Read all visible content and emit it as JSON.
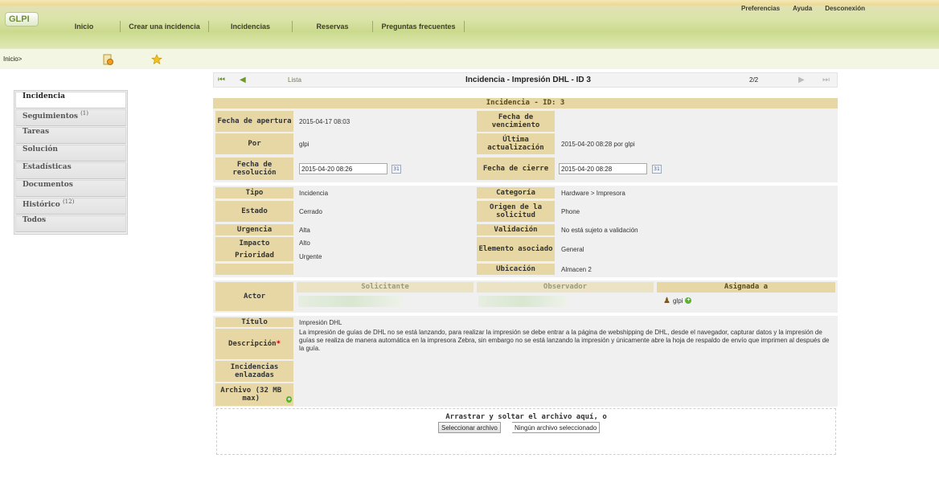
{
  "app": {
    "logo_text": "GLPI"
  },
  "header": {
    "nav": [
      "Inicio",
      "Crear una incidencia",
      "Incidencias",
      "Reservas",
      "Preguntas frecuentes"
    ],
    "user_links": [
      "Preferencias",
      "Ayuda",
      "Desconexión"
    ]
  },
  "breadcrumb": {
    "text": "Inicio>"
  },
  "sidebar": {
    "tabs": [
      {
        "label": "Incidencia",
        "count": "",
        "active": true
      },
      {
        "label": "Seguimientos",
        "count": "(1)",
        "active": false
      },
      {
        "label": "Tareas",
        "count": "",
        "active": false
      },
      {
        "label": "Solución",
        "count": "",
        "active": false
      },
      {
        "label": "Estadísticas",
        "count": "",
        "active": false
      },
      {
        "label": "Documentos",
        "count": "",
        "active": false
      },
      {
        "label": "Histórico",
        "count": "(12)",
        "active": false
      },
      {
        "label": "Todos",
        "count": "",
        "active": false
      }
    ]
  },
  "formnav": {
    "list_label": "Lista",
    "title": "Incidencia - Impresión DHL - ID 3",
    "position": "2/2"
  },
  "ticket": {
    "header": "Incidencia - ID: 3",
    "labels": {
      "fecha_apertura": "Fecha de apertura",
      "fecha_vencimiento": "Fecha de vencimiento",
      "por": "Por",
      "ultima_actualizacion": "Última actualización",
      "fecha_resolucion": "Fecha de resolución",
      "fecha_cierre": "Fecha de cierre",
      "tipo": "Tipo",
      "categoria": "Categoría",
      "estado": "Estado",
      "origen": "Origen de la solicitud",
      "urgencia": "Urgencia",
      "validacion": "Validación",
      "impacto": "Impacto",
      "elemento": "Elemento asociado",
      "prioridad": "Prioridad",
      "ubicacion": "Ubicación",
      "actor": "Actor",
      "solicitante": "Solicitante",
      "observador": "Observador",
      "asignada": "Asignada a",
      "titulo": "Título",
      "descripcion": "Descripción",
      "enlazadas": "Incidencias enlazadas",
      "archivo": "Archivo (32 MB max)"
    },
    "values": {
      "fecha_apertura": "2015-04-17 08:03",
      "por": "glpi",
      "ultima_actualizacion": "2015-04-20 08:28 por glpi",
      "fecha_resolucion": "2015-04-20 08:26",
      "fecha_cierre": "2015-04-20 08:28",
      "tipo": "Incidencia",
      "categoria": "Hardware > Impresora",
      "estado": "Cerrado",
      "origen": "Phone",
      "urgencia": "Alta",
      "validacion": "No está sujeto a validación",
      "impacto": "Alto",
      "elemento": "General",
      "prioridad": "Urgente",
      "ubicacion": "Almacen 2",
      "asignada_user": "glpi",
      "titulo": "Impresión DHL",
      "descripcion": "La impresión de guías de DHL no se está lanzando, para realizar la impresión se debe entrar a la página de webshipping de DHL, desde el navegador, capturar datos y la impresión de guías se realiza de manera automática en la impresora Zebra, sin embargo no se está lanzando la impresión y únicamente abre la hoja de respaldo de envío que imprimen al después de la guía."
    },
    "required_mark": "*",
    "calendar_icon_text": "31"
  },
  "upload": {
    "drop_message": "Arrastrar y soltar el archivo aquí, o",
    "button": "Seleccionar archivo",
    "status": "Ningún archivo seleccionado"
  },
  "icons": {
    "first": "⏮",
    "prev": "◀",
    "next": "▶",
    "last": "⏭",
    "add": "+",
    "user": "♟"
  }
}
